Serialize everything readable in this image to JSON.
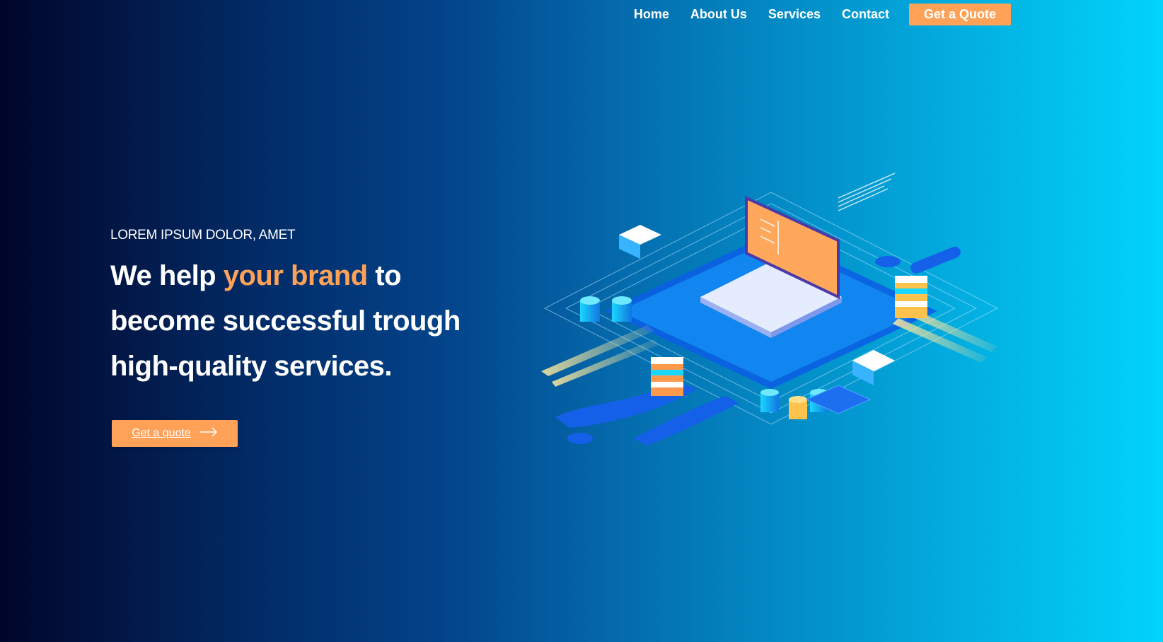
{
  "nav": {
    "items": [
      "Home",
      "About Us",
      "Services",
      "Contact"
    ],
    "cta_label": "Get a Quote"
  },
  "hero": {
    "eyebrow": "LOREM IPSUM DOLOR, AMET",
    "headline_before": "We help ",
    "headline_accent": "your brand",
    "headline_after": " to become successful trough high-quality services.",
    "cta_label": "Get a quote"
  },
  "colors": {
    "accent": "#ffa257",
    "bg_start": "#01052a",
    "bg_end": "#02d4fb"
  },
  "icons": {
    "cta_arrow": "arrow-right-icon",
    "illustration": "isometric-datacenter-illustration"
  }
}
